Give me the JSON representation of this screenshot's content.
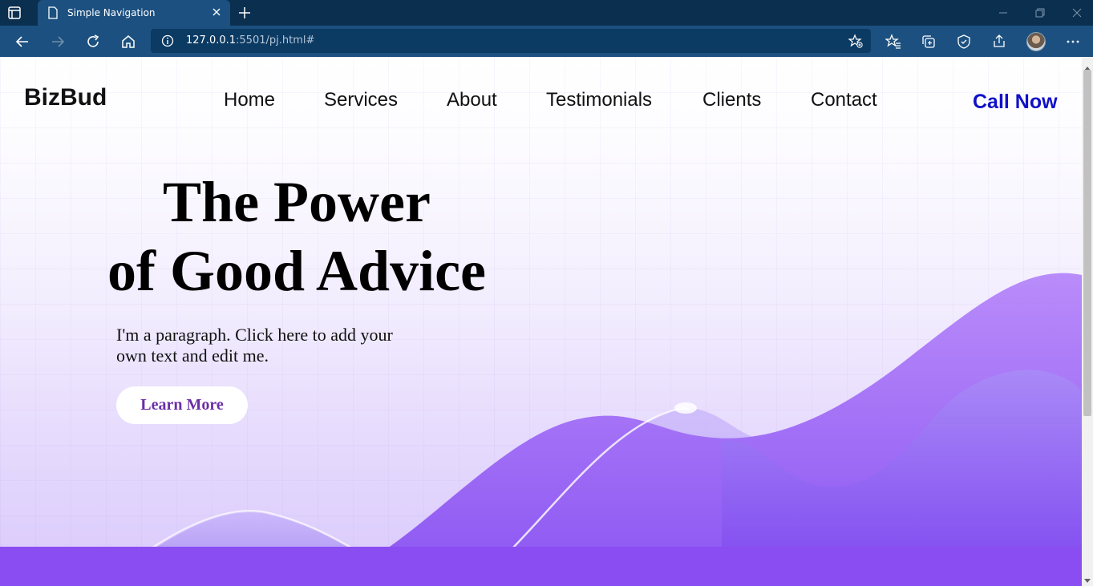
{
  "browser": {
    "tab_title": "Simple Navigation",
    "url_host": "127.0.0.1",
    "url_rest": ":5501/pj.html#",
    "icons": [
      "tab-actions-icon",
      "page-icon",
      "close-icon",
      "plus-icon",
      "minimize-icon",
      "restore-icon",
      "window-close-icon",
      "back-icon",
      "forward-icon",
      "refresh-icon",
      "home-icon",
      "info-icon",
      "add-favorite-icon",
      "favorites-icon",
      "collections-icon",
      "browser-essentials-icon",
      "share-icon",
      "more-icon"
    ]
  },
  "site": {
    "logo": "BizBud",
    "nav": [
      "Home",
      "Services",
      "About",
      "Testimonials",
      "Clients",
      "Contact"
    ],
    "call": "Call Now"
  },
  "hero": {
    "title_line1": "The Power",
    "title_line2": "of Good Advice",
    "paragraph": "I'm a paragraph. Click here to add your own text and edit me.",
    "button": "Learn More"
  },
  "colors": {
    "chrome_dark": "#0b2f4f",
    "chrome": "#1c5080",
    "call_blue": "#1010c8",
    "button_text": "#6b2fa8",
    "wave_purple": "#9b6cf6",
    "wave_deep": "#7d45f0"
  }
}
